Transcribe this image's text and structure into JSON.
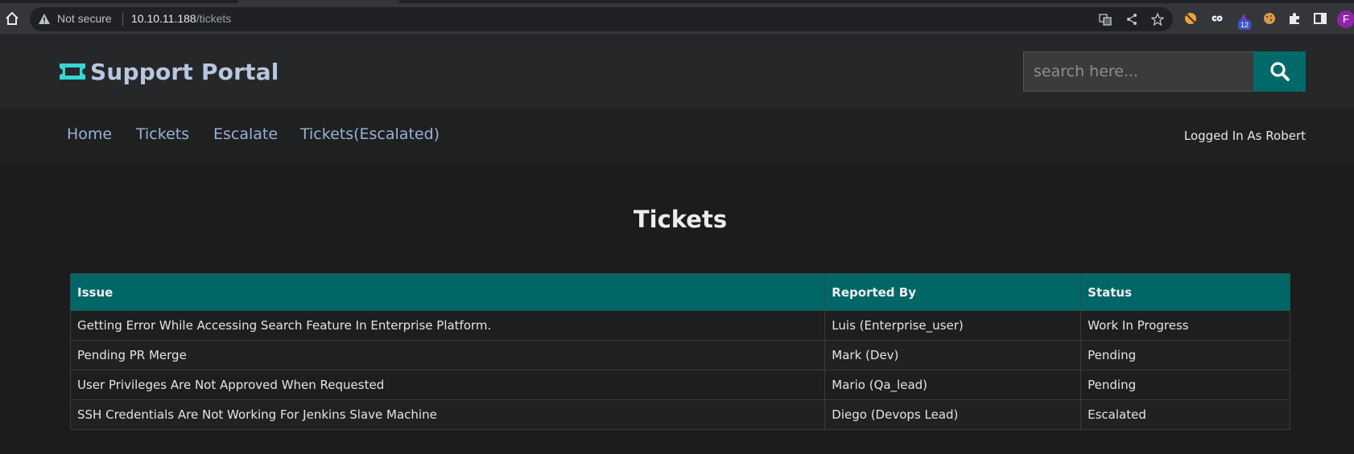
{
  "browser": {
    "security_label": "Not secure",
    "url_host": "10.10.11.188",
    "url_path": "/tickets",
    "extension_badge": "12",
    "profile_initial": "F"
  },
  "header": {
    "logo_text": "Support Portal",
    "search_placeholder": "search here..."
  },
  "nav": {
    "items": [
      "Home",
      "Tickets",
      "Escalate",
      "Tickets(Escalated)"
    ],
    "logged_in": "Logged In As Robert"
  },
  "main": {
    "title": "Tickets",
    "columns": [
      "Issue",
      "Reported By",
      "Status"
    ],
    "rows": [
      [
        "Getting Error While Accessing Search Feature In Enterprise Platform.",
        "Luis (Enterprise_user)",
        "Work In Progress"
      ],
      [
        "Pending PR Merge",
        "Mark (Dev)",
        "Pending"
      ],
      [
        "User Privileges Are Not Approved When Requested",
        "Mario (Qa_lead)",
        "Pending"
      ],
      [
        "SSH Credentials Are Not Working For Jenkins Slave Machine",
        "Diego (Devops Lead)",
        "Escalated"
      ]
    ]
  },
  "colors": {
    "accent": "#006666",
    "logo": "#b8c7e0",
    "nav_link": "#9ab1d3"
  }
}
